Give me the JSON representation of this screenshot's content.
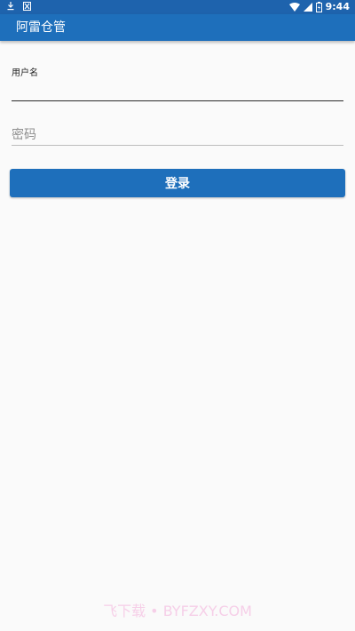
{
  "status_bar": {
    "time": "9:44",
    "left_icons": [
      "download-icon",
      "notification-icon"
    ],
    "right_icons": [
      "wifi-icon",
      "signal-icon",
      "battery-icon"
    ]
  },
  "app_bar": {
    "title": "阿雷仓管"
  },
  "login_form": {
    "username_label": "用户名",
    "username_value": "",
    "password_placeholder": "密码",
    "password_value": "",
    "login_button_label": "登录"
  },
  "watermark": "飞下载 • BYFZXY.COM",
  "colors": {
    "status_bar": "#1e63ad",
    "app_bar": "#1e6fbb",
    "button": "#1e6fbb",
    "background": "#fafafa"
  }
}
